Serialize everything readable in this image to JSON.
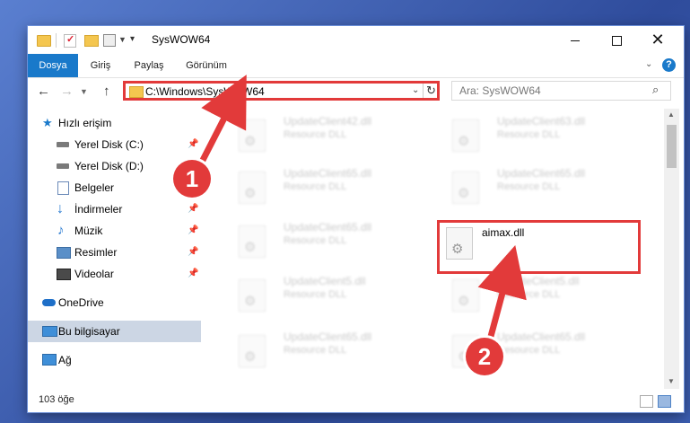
{
  "window": {
    "title": "SysWOW64"
  },
  "ribbon": {
    "tabs": [
      "Dosya",
      "Giriş",
      "Paylaş",
      "Görünüm"
    ]
  },
  "nav": {
    "address": "C:\\Windows\\SysWOW64",
    "search_placeholder": "Ara: SysWOW64"
  },
  "sidebar": {
    "items": [
      {
        "label": "Hızlı erişim",
        "icon": "star-icon",
        "pinned": false
      },
      {
        "label": "Yerel Disk (C:)",
        "icon": "drive-icon",
        "pinned": true
      },
      {
        "label": "Yerel Disk (D:)",
        "icon": "drive-icon",
        "pinned": true
      },
      {
        "label": "Belgeler",
        "icon": "documents-icon",
        "pinned": true
      },
      {
        "label": "İndirmeler",
        "icon": "download-icon",
        "pinned": true
      },
      {
        "label": "Müzik",
        "icon": "music-icon",
        "pinned": true
      },
      {
        "label": "Resimler",
        "icon": "pictures-icon",
        "pinned": true
      },
      {
        "label": "Videolar",
        "icon": "videos-icon",
        "pinned": true
      },
      {
        "label": "OneDrive",
        "icon": "cloud-icon",
        "pinned": false
      },
      {
        "label": "Bu bilgisayar",
        "icon": "computer-icon",
        "pinned": false
      },
      {
        "label": "Ağ",
        "icon": "network-icon",
        "pinned": false
      }
    ]
  },
  "files": [
    {
      "name": "UpdateClient42.dll",
      "type": "Resource DLL"
    },
    {
      "name": "UpdateClient63.dll",
      "type": "Resource DLL"
    },
    {
      "name": "UpdateClient65.dll",
      "type": "Resource DLL"
    },
    {
      "name": "UpdateClient65.dll",
      "type": "Resource DLL"
    },
    {
      "name": "UpdateClient65.dll",
      "type": "Resource DLL"
    },
    {
      "name": "aimax.dll",
      "type": ""
    },
    {
      "name": "UpdateClient5.dll",
      "type": "Resource DLL"
    },
    {
      "name": "UpdateClient5.dll",
      "type": "Resource DLL"
    },
    {
      "name": "UpdateClient65.dll",
      "type": "Resource DLL"
    },
    {
      "name": "UpdateClient65.dll",
      "type": "Resource DLL"
    }
  ],
  "status": {
    "item_count": "103 öğe"
  },
  "annotations": {
    "badge1": "1",
    "badge2": "2",
    "color": "#e23a3a"
  }
}
